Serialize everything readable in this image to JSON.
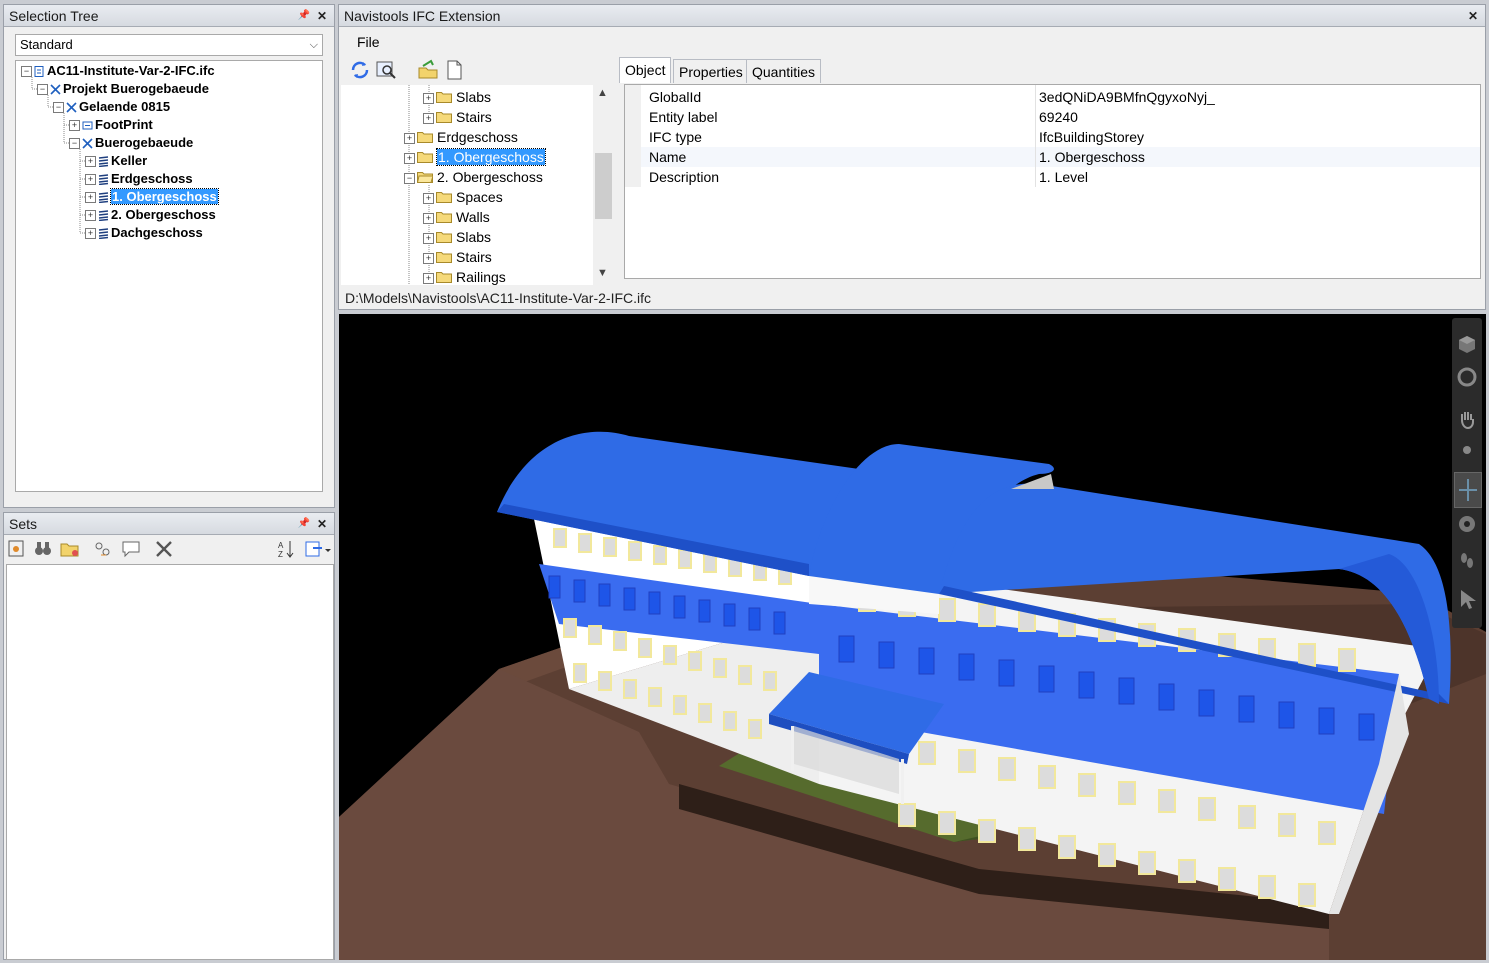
{
  "selection_tree": {
    "title": "Selection Tree",
    "combo_value": "Standard",
    "items": [
      {
        "label": "AC11-Institute-Var-2-IFC.ifc",
        "icon": "file-icon"
      },
      {
        "label": "Projekt Buerogebaeude",
        "icon": "cross-icon"
      },
      {
        "label": "Gelaende 0815",
        "icon": "cross-icon"
      },
      {
        "label": "FootPrint",
        "icon": "layer-icon"
      },
      {
        "label": "Buerogebaeude",
        "icon": "cross-icon"
      },
      {
        "label": "Keller",
        "icon": "layers-icon"
      },
      {
        "label": "Erdgeschoss",
        "icon": "layers-icon"
      },
      {
        "label": "1. Obergeschoss",
        "icon": "layers-icon"
      },
      {
        "label": "2. Obergeschoss",
        "icon": "layers-icon"
      },
      {
        "label": "Dachgeschoss",
        "icon": "layers-icon"
      }
    ]
  },
  "sets": {
    "title": "Sets"
  },
  "ifc_extension": {
    "title": "Navistools IFC Extension",
    "menu_file": "File",
    "tree_items": [
      {
        "label": "Slabs"
      },
      {
        "label": "Stairs"
      },
      {
        "label": "Erdgeschoss"
      },
      {
        "label": "1. Obergeschoss"
      },
      {
        "label": "2. Obergeschoss"
      },
      {
        "label": "Spaces"
      },
      {
        "label": "Walls"
      },
      {
        "label": "Slabs"
      },
      {
        "label": "Stairs"
      },
      {
        "label": "Railings"
      }
    ],
    "tabs": [
      "Object",
      "Properties",
      "Quantities"
    ],
    "properties": [
      {
        "key": "GlobalId",
        "value": "3edQNiDA9BMfnQgyxoNyj_"
      },
      {
        "key": "Entity label",
        "value": "69240"
      },
      {
        "key": "IFC type",
        "value": "IfcBuildingStorey"
      },
      {
        "key": "Name",
        "value": "1. Obergeschoss"
      },
      {
        "key": "Description",
        "value": "1. Level"
      }
    ],
    "status_path": "D:\\Models\\Navistools\\AC11-Institute-Var-2-IFC.ifc"
  },
  "colors": {
    "roof": "#2f6be6",
    "band": "#3a6cf0",
    "ground": "#5c3f33",
    "grass": "#566b2d",
    "selection": "#3399ff"
  }
}
